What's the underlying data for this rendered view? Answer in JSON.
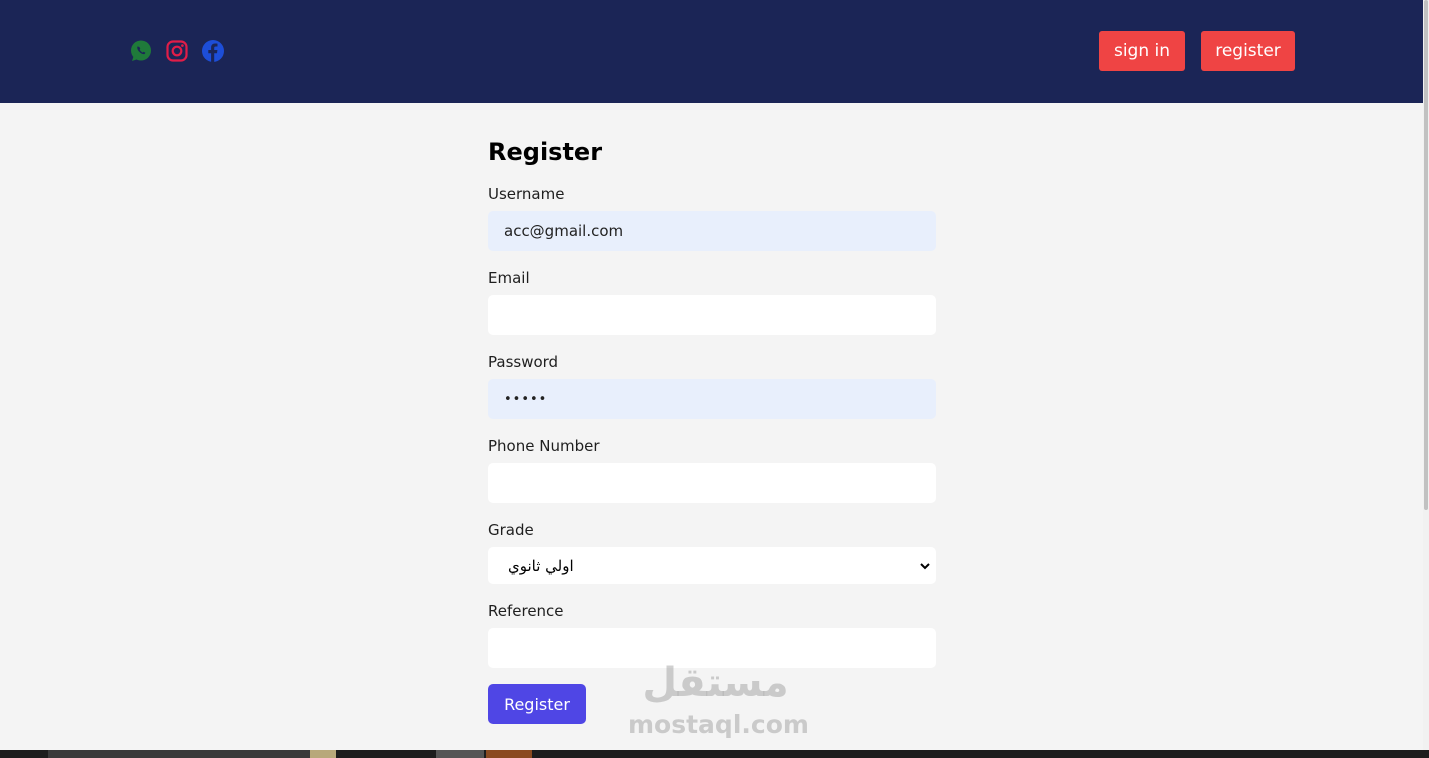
{
  "header": {
    "social_icons": [
      "whatsapp-icon",
      "instagram-icon",
      "facebook-icon"
    ],
    "social_colors": {
      "whatsapp": "#1f7a3a",
      "instagram": "#e11d48",
      "facebook": "#1d4ed8"
    },
    "signin_label": "sign in",
    "register_label": "register",
    "background": "#1b2556",
    "button_color": "#ef4444"
  },
  "form": {
    "title": "Register",
    "username": {
      "label": "Username",
      "value": "acc@gmail.com"
    },
    "email": {
      "label": "Email",
      "value": ""
    },
    "password": {
      "label": "Password",
      "value": "•••••"
    },
    "phone": {
      "label": "Phone Number",
      "value": ""
    },
    "grade": {
      "label": "Grade",
      "selected": "اولي ثانوي"
    },
    "reference": {
      "label": "Reference",
      "value": ""
    },
    "submit_label": "Register",
    "submit_color": "#4f46e5"
  },
  "watermark": {
    "arabic": "مستقل",
    "latin": "mostaql.com"
  }
}
